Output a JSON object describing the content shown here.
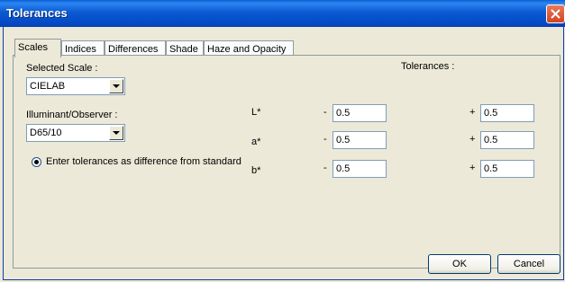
{
  "window": {
    "title": "Tolerances"
  },
  "tabs": [
    {
      "label": "Scales"
    },
    {
      "label": "Indices"
    },
    {
      "label": "Differences"
    },
    {
      "label": "Shade"
    },
    {
      "label": "Haze and Opacity"
    }
  ],
  "scale": {
    "label": "Selected Scale :",
    "value": "CIELAB"
  },
  "illuminant": {
    "label": "Illuminant/Observer :",
    "value": "D65/10"
  },
  "radio_option": {
    "label": "Enter tolerances as difference from standard",
    "checked": true
  },
  "tolerances": {
    "header": "Tolerances :",
    "rows": [
      {
        "label": "L*",
        "minus_sign": "-",
        "minus_value": "0.5",
        "plus_sign": "+",
        "plus_value": "0.5"
      },
      {
        "label": "a*",
        "minus_sign": "-",
        "minus_value": "0.5",
        "plus_sign": "+",
        "plus_value": "0.5"
      },
      {
        "label": "b*",
        "minus_sign": "-",
        "minus_value": "0.5",
        "plus_sign": "+",
        "plus_value": "0.5"
      }
    ]
  },
  "buttons": {
    "ok": "OK",
    "cancel": "Cancel"
  },
  "colors": {
    "titlebar": "#0b5ad3",
    "face": "#ece9d8",
    "close": "#d3441f"
  },
  "icons": {
    "close": "close-icon",
    "dropdown": "chevron-down-icon"
  }
}
